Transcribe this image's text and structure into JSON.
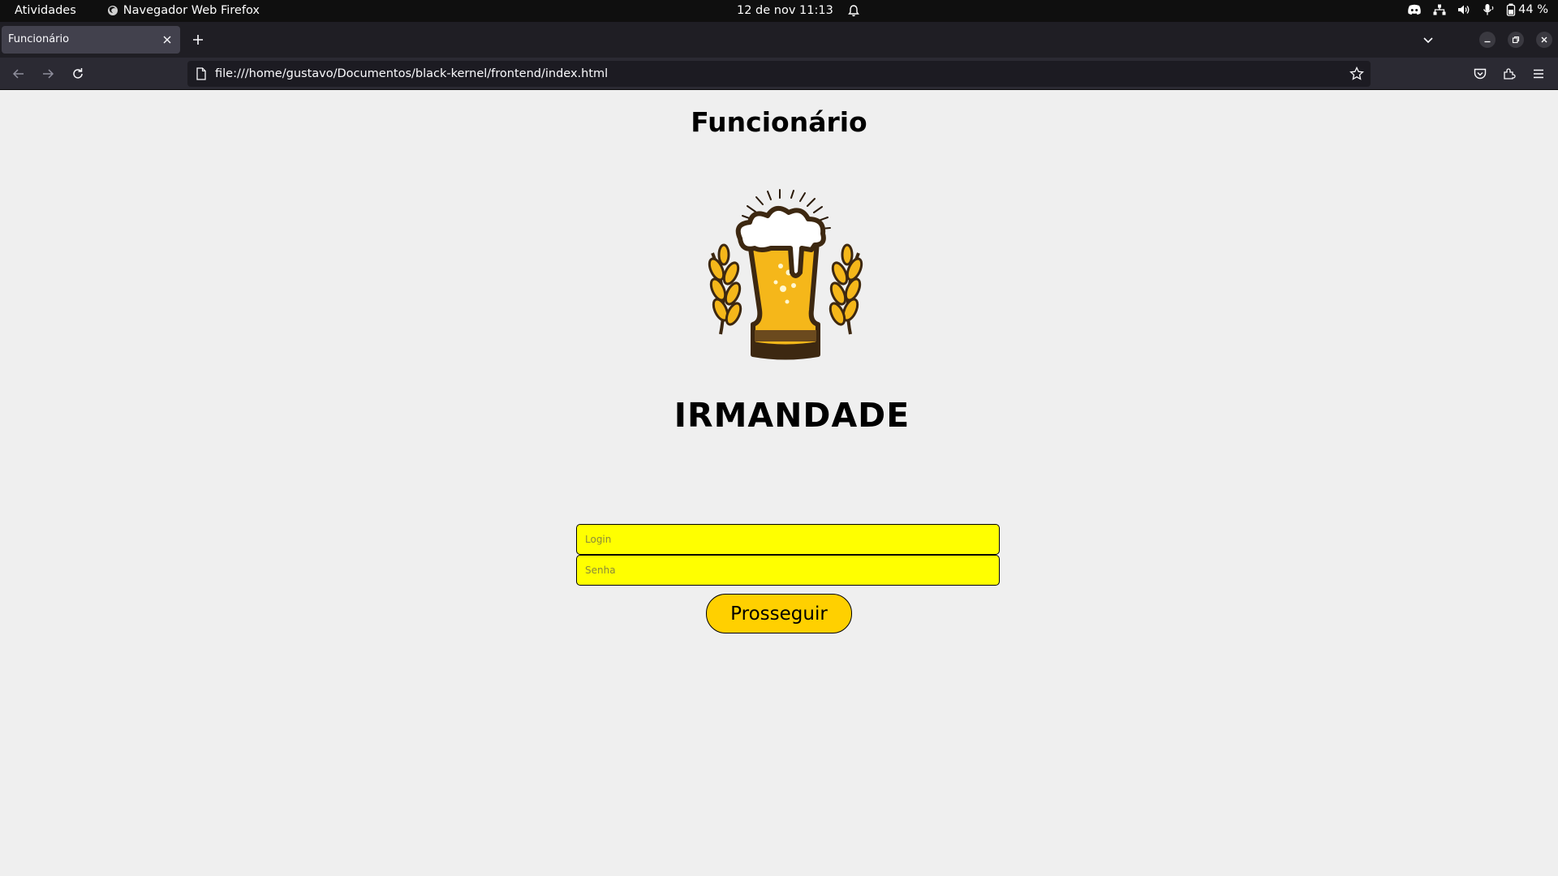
{
  "topbar": {
    "activities": "Atividades",
    "app_name": "Navegador Web Firefox",
    "clock": "12 de nov  11:13",
    "battery": "44 %"
  },
  "browser": {
    "tab_title": "Funcionário",
    "url": "file:///home/gustavo/Documentos/black-kernel/frontend/index.html"
  },
  "page": {
    "title": "Funcionário",
    "brand": "IRMANDADE",
    "login_placeholder": "Login",
    "senha_placeholder": "Senha",
    "submit_label": "Prosseguir"
  },
  "colors": {
    "field_bg": "#ffff00",
    "button_bg": "#ffd000",
    "beer": "#f5b71a",
    "outline": "#3d2811"
  }
}
